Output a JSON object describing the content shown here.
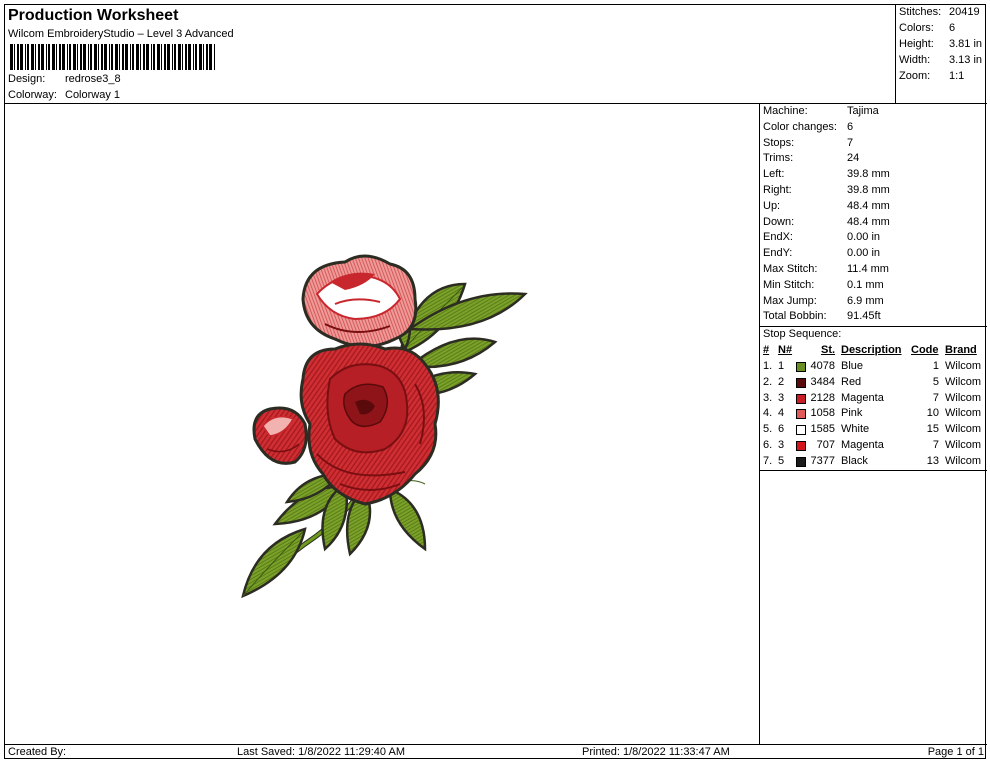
{
  "header": {
    "title": "Production Worksheet",
    "software": "Wilcom EmbroideryStudio – Level 3 Advanced",
    "design_label": "Design:",
    "design_value": "redrose3_8",
    "colorway_label": "Colorway:",
    "colorway_value": "Colorway 1"
  },
  "summary": {
    "stitches_label": "Stitches:",
    "stitches_value": "20419",
    "colors_label": "Colors:",
    "colors_value": "6",
    "height_label": "Height:",
    "height_value": "3.81 in",
    "width_label": "Width:",
    "width_value": "3.13 in",
    "zoom_label": "Zoom:",
    "zoom_value": "1:1"
  },
  "machine_info": [
    {
      "label": "Machine:",
      "value": "Tajima"
    },
    {
      "label": "Color changes:",
      "value": "6"
    },
    {
      "label": "Stops:",
      "value": "7"
    },
    {
      "label": "Trims:",
      "value": "24"
    },
    {
      "label": "Left:",
      "value": "39.8 mm"
    },
    {
      "label": "Right:",
      "value": "39.8 mm"
    },
    {
      "label": "Up:",
      "value": "48.4 mm"
    },
    {
      "label": "Down:",
      "value": "48.4 mm"
    },
    {
      "label": "EndX:",
      "value": "0.00 in"
    },
    {
      "label": "EndY:",
      "value": "0.00 in"
    },
    {
      "label": "Max Stitch:",
      "value": "11.4 mm"
    },
    {
      "label": "Min Stitch:",
      "value": "0.1 mm"
    },
    {
      "label": "Max Jump:",
      "value": "6.9 mm"
    },
    {
      "label": "Total Bobbin:",
      "value": "91.45ft"
    }
  ],
  "stop_sequence": {
    "title": "Stop Sequence:",
    "headers": {
      "num": "#",
      "n": "N#",
      "st": "St.",
      "desc": "Description",
      "code": "Code",
      "brand": "Brand"
    },
    "rows": [
      {
        "num": "1.",
        "n": "1",
        "color": "#6b8e23",
        "st": "4078",
        "desc": "Blue",
        "code": "1",
        "brand": "Wilcom"
      },
      {
        "num": "2.",
        "n": "2",
        "color": "#5a0a0a",
        "st": "3484",
        "desc": "Red",
        "code": "5",
        "brand": "Wilcom"
      },
      {
        "num": "3.",
        "n": "3",
        "color": "#c81d25",
        "st": "2128",
        "desc": "Magenta",
        "code": "7",
        "brand": "Wilcom"
      },
      {
        "num": "4.",
        "n": "4",
        "color": "#e05a5a",
        "st": "1058",
        "desc": "Pink",
        "code": "10",
        "brand": "Wilcom"
      },
      {
        "num": "5.",
        "n": "6",
        "color": "#ffffff",
        "st": "1585",
        "desc": "White",
        "code": "15",
        "brand": "Wilcom"
      },
      {
        "num": "6.",
        "n": "3",
        "color": "#d4141c",
        "st": "707",
        "desc": "Magenta",
        "code": "7",
        "brand": "Wilcom"
      },
      {
        "num": "7.",
        "n": "5",
        "color": "#1a1a1a",
        "st": "7377",
        "desc": "Black",
        "code": "13",
        "brand": "Wilcom"
      }
    ]
  },
  "footer": {
    "created_by": "Created By:",
    "last_saved": "Last Saved: 1/8/2022 11:29:40 AM",
    "printed": "Printed: 1/8/2022 11:33:47 AM",
    "page": "Page 1 of 1"
  },
  "artwork": {
    "subject": "embroidered red rose with buds and green leaves",
    "colors": {
      "petal": "#c8282d",
      "petal_dark": "#7a0f12",
      "petal_light": "#f2b3b0",
      "leaf": "#6e9b1e",
      "leaf_dark": "#3d5c12",
      "outline": "#2c2c22"
    }
  }
}
